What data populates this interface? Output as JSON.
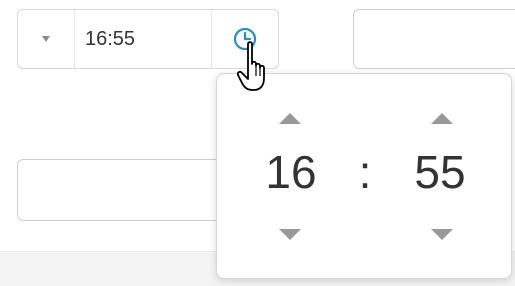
{
  "time_field": {
    "value": "16:55",
    "toggle_icon": "caret-down-icon",
    "clock_icon": "clock-icon"
  },
  "time_picker": {
    "hours": "16",
    "separator": ":",
    "minutes": "55",
    "increment_icon": "triangle-up-icon",
    "decrement_icon": "triangle-down-icon"
  },
  "colors": {
    "accent": "#1f8fd6",
    "arrow": "#999999",
    "text": "#333333",
    "border": "#d9d9d9"
  },
  "cursor": "pointer-hand-icon"
}
